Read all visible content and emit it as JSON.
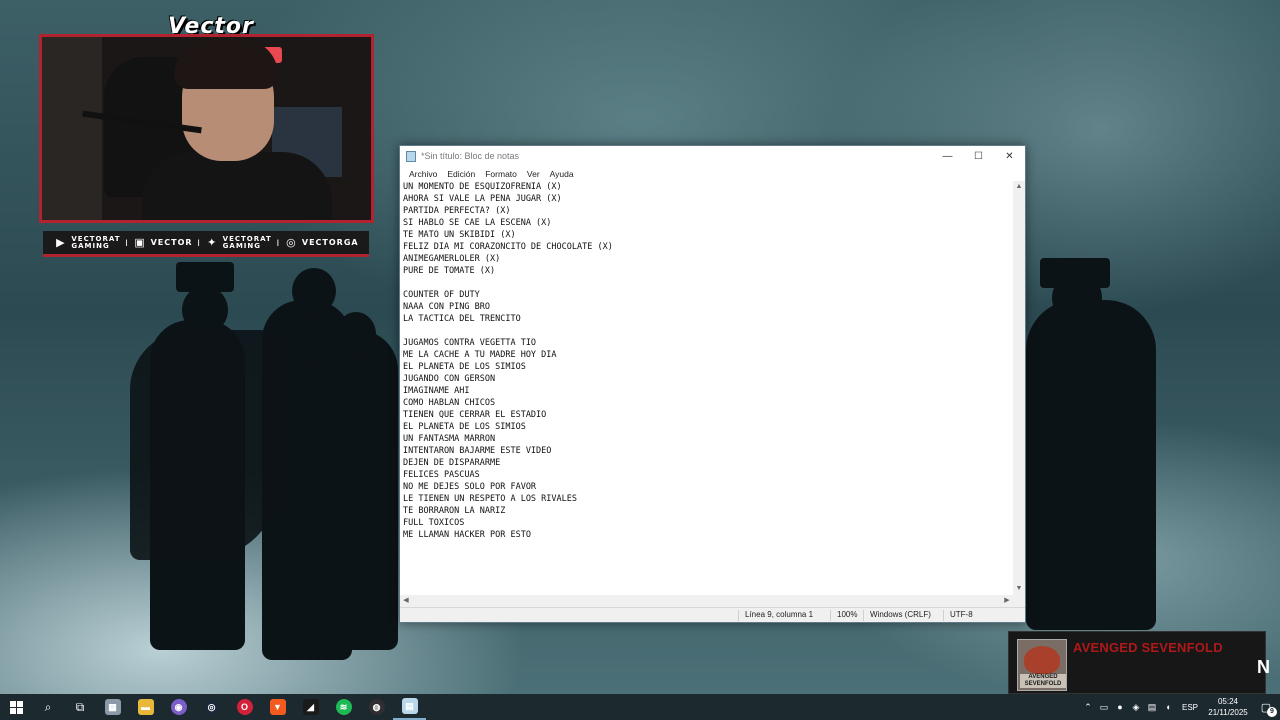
{
  "stream_overlay": {
    "streamer_logo_text": "Vector",
    "socials": [
      {
        "icon": "youtube-icon",
        "line1": "VECTORAT",
        "line2": "GAMING"
      },
      {
        "icon": "twitch-icon",
        "line1": "VECTOR",
        "line2": ""
      },
      {
        "icon": "twitter-icon",
        "line1": "VECTORAT",
        "line2": "GAMING"
      },
      {
        "icon": "instagram-icon",
        "line1": "VECTORGA",
        "line2": ""
      }
    ],
    "separator": "I",
    "accent_color": "#b3232f"
  },
  "notepad": {
    "title": "*Sin título: Bloc de notas",
    "controls": {
      "minimize": "—",
      "maximize": "☐",
      "close": "✕"
    },
    "menu": [
      "Archivo",
      "Edición",
      "Formato",
      "Ver",
      "Ayuda"
    ],
    "lines": [
      "UN MOMENTO DE ESQUIZOFRENIA (X)",
      "AHORA SI VALE LA PENA JUGAR (X)",
      "PARTIDA PERFECTA? (X)",
      "SI HABLO SE CAE LA ESCENA (X)",
      "TE MATO UN SKIBIDI (X)",
      "FELIZ DIA MI CORAZONCITO DE CHOCOLATE (X)",
      "ANIMEGAMERLOLER (X)",
      "PURE DE TOMATE (X)",
      "",
      "COUNTER OF DUTY",
      "NAAA CON PING BRO",
      "LA TACTICA DEL TRENCITO",
      "",
      "JUGAMOS CONTRA VEGETTA TIO",
      "ME LA CACHE A TU MADRE HOY DIA",
      "EL PLANETA DE LOS SIMIOS",
      "JUGANDO CON GERSON",
      "IMAGINAME AHI",
      "COMO HABLAN CHICOS",
      "TIENEN QUE CERRAR EL ESTADIO",
      "EL PLANETA DE LOS SIMIOS",
      "UN FANTASMA MARRON",
      "INTENTARON BAJARME ESTE VIDEO",
      "DEJEN DE DISPARARME",
      "FELICES PASCUAS",
      "NO ME DEJES SOLO POR FAVOR",
      "LE TIENEN UN RESPETO A LOS RIVALES",
      "TE BORRARON LA NARIZ",
      "FULL TOXICOS",
      "ME LLAMAN HACKER POR ESTO"
    ],
    "status": {
      "position": "Línea 9, columna 1",
      "zoom": "100%",
      "line_ending": "Windows (CRLF)",
      "encoding": "UTF-8"
    }
  },
  "now_playing": {
    "artist": "AVENGED SEVENFOLD",
    "track_partial": "N",
    "album_art_text": "AVENGED SEVENFOLD",
    "artist_color": "#b01818"
  },
  "taskbar": {
    "apps": [
      {
        "name": "file-manager-icon",
        "color": "#8a9aa6"
      },
      {
        "name": "folder-icon",
        "color": "#e8b83a"
      },
      {
        "name": "discord-icon",
        "color": "#7b5ec8"
      },
      {
        "name": "steam-icon",
        "color": "#1b2838"
      },
      {
        "name": "opera-icon",
        "color": "#d3213a"
      },
      {
        "name": "brave-icon",
        "color": "#f25a1e"
      },
      {
        "name": "racing-app-icon",
        "color": "#1a1a1a"
      },
      {
        "name": "spotify-icon",
        "color": "#1db954"
      },
      {
        "name": "obs-icon",
        "color": "#302e31"
      },
      {
        "name": "notepad-icon",
        "color": "#b9d7ea"
      }
    ],
    "language": "ESP",
    "time": "05:24",
    "date": "21/11/2025",
    "notification_count": "9"
  }
}
